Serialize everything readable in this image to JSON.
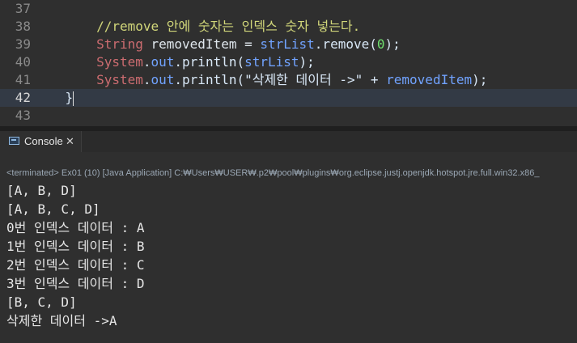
{
  "editor": {
    "lines": [
      {
        "num": "37",
        "code": []
      },
      {
        "num": "38",
        "code": [
          {
            "cls": "c-comment",
            "text": "        //remove 안에 숫자는 인덱스 숫자 넣는다."
          }
        ]
      },
      {
        "num": "39",
        "code": [
          {
            "cls": "c-plain",
            "text": "        "
          },
          {
            "cls": "c-type",
            "text": "String"
          },
          {
            "cls": "c-var",
            "text": " removedItem = "
          },
          {
            "cls": "c-field",
            "text": "strList"
          },
          {
            "cls": "c-plain",
            "text": ".remove("
          },
          {
            "cls": "c-num",
            "text": "0"
          },
          {
            "cls": "c-plain",
            "text": ");"
          }
        ]
      },
      {
        "num": "40",
        "code": [
          {
            "cls": "c-plain",
            "text": "        "
          },
          {
            "cls": "c-type",
            "text": "System"
          },
          {
            "cls": "c-plain",
            "text": "."
          },
          {
            "cls": "c-field",
            "text": "out"
          },
          {
            "cls": "c-plain",
            "text": ".println("
          },
          {
            "cls": "c-field",
            "text": "strList"
          },
          {
            "cls": "c-plain",
            "text": ");"
          }
        ]
      },
      {
        "num": "41",
        "code": [
          {
            "cls": "c-plain",
            "text": "        "
          },
          {
            "cls": "c-type",
            "text": "System"
          },
          {
            "cls": "c-plain",
            "text": "."
          },
          {
            "cls": "c-field",
            "text": "out"
          },
          {
            "cls": "c-plain",
            "text": ".println("
          },
          {
            "cls": "c-str",
            "text": "\"삭제한 데이터 ->\""
          },
          {
            "cls": "c-plain",
            "text": " + "
          },
          {
            "cls": "c-field",
            "text": "removedItem"
          },
          {
            "cls": "c-plain",
            "text": ");"
          }
        ]
      },
      {
        "num": "42",
        "code": [
          {
            "cls": "c-plain",
            "text": "    }"
          }
        ],
        "current": true
      },
      {
        "num": "43",
        "code": []
      }
    ]
  },
  "console": {
    "tab_label": "Console",
    "tab_close": "✕",
    "status": "<terminated> Ex01 (10) [Java Application] C:₩Users₩USER₩.p2₩pool₩plugins₩org.eclipse.justj.openjdk.hotspot.jre.full.win32.x86_",
    "output": [
      "[A, B, D]",
      "[A, B, C, D]",
      "0번 인덱스 데이터 : A",
      "1번 인덱스 데이터 : B",
      "2번 인덱스 데이터 : C",
      "3번 인덱스 데이터 : D",
      "[B, C, D]",
      "삭제한 데이터 ->A"
    ]
  },
  "colors": {
    "background": "#2f2f2f",
    "comment": "#d2d77a",
    "type": "#cc6c70",
    "field": "#71a3ff",
    "number": "#6fe06f"
  },
  "icons": {
    "console_tab": "console-icon",
    "close": "close-icon"
  }
}
